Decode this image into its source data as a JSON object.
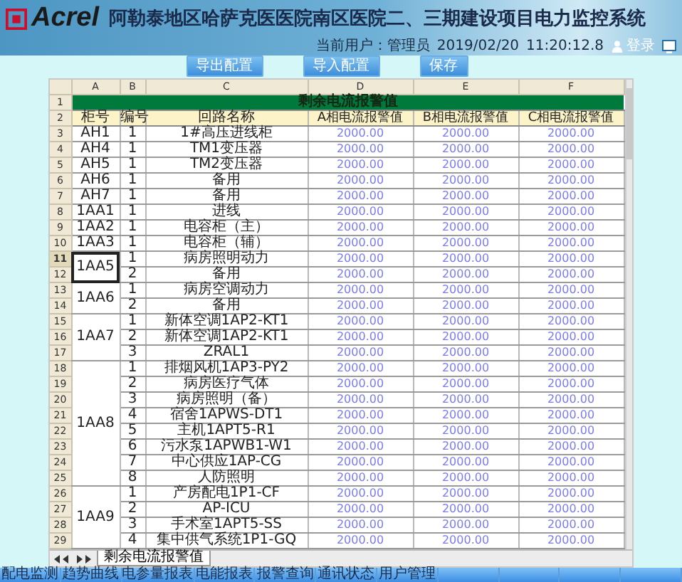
{
  "header": {
    "logo": "Acrel",
    "title": "阿勒泰地区哈萨克医医院南区医院二、三期建设项目电力监控系统",
    "user_label": "当前用户：",
    "user": "管理员",
    "date": "2019/02/20",
    "time": "11:20:12.8",
    "login": "登录"
  },
  "toolbar": [
    "导出配置",
    "导入配置",
    "保存"
  ],
  "sheet": {
    "column_letters": [
      "A",
      "B",
      "C",
      "D",
      "E",
      "F"
    ],
    "title_row_number": "1",
    "title": "剩余电流报警值",
    "header_row_number": "2",
    "headers": [
      "柜号",
      "编号",
      "回路名称",
      "A相电流报警值",
      "B相电流报警值",
      "C相电流报警值"
    ],
    "groups": [
      {
        "cabinet": "AH1",
        "selected": false,
        "rows": [
          {
            "row_number": "3",
            "no": "1",
            "name": "1#高压进线柜",
            "values": [
              "2000.00",
              "2000.00",
              "2000.00"
            ]
          }
        ]
      },
      {
        "cabinet": "AH4",
        "selected": false,
        "rows": [
          {
            "row_number": "4",
            "no": "1",
            "name": "TM1变压器",
            "values": [
              "2000.00",
              "2000.00",
              "2000.00"
            ]
          }
        ]
      },
      {
        "cabinet": "AH5",
        "selected": false,
        "rows": [
          {
            "row_number": "5",
            "no": "1",
            "name": "TM2变压器",
            "values": [
              "2000.00",
              "2000.00",
              "2000.00"
            ]
          }
        ]
      },
      {
        "cabinet": "AH6",
        "selected": false,
        "rows": [
          {
            "row_number": "6",
            "no": "1",
            "name": "备用",
            "values": [
              "2000.00",
              "2000.00",
              "2000.00"
            ]
          }
        ]
      },
      {
        "cabinet": "AH7",
        "selected": false,
        "rows": [
          {
            "row_number": "7",
            "no": "1",
            "name": "备用",
            "values": [
              "2000.00",
              "2000.00",
              "2000.00"
            ]
          }
        ]
      },
      {
        "cabinet": "1AA1",
        "selected": false,
        "rows": [
          {
            "row_number": "8",
            "no": "1",
            "name": "进线",
            "values": [
              "2000.00",
              "2000.00",
              "2000.00"
            ]
          }
        ]
      },
      {
        "cabinet": "1AA2",
        "selected": false,
        "rows": [
          {
            "row_number": "9",
            "no": "1",
            "name": "电容柜（主）",
            "values": [
              "2000.00",
              "2000.00",
              "2000.00"
            ]
          }
        ]
      },
      {
        "cabinet": "1AA3",
        "selected": false,
        "rows": [
          {
            "row_number": "10",
            "no": "1",
            "name": "电容柜（辅）",
            "values": [
              "2000.00",
              "2000.00",
              "2000.00"
            ]
          }
        ]
      },
      {
        "cabinet": "1AA5",
        "selected": true,
        "rows": [
          {
            "row_number": "11",
            "no": "1",
            "name": "病房照明动力",
            "values": [
              "2000.00",
              "2000.00",
              "2000.00"
            ]
          },
          {
            "row_number": "12",
            "no": "2",
            "name": "备用",
            "values": [
              "2000.00",
              "2000.00",
              "2000.00"
            ]
          }
        ]
      },
      {
        "cabinet": "1AA6",
        "selected": false,
        "rows": [
          {
            "row_number": "13",
            "no": "1",
            "name": "病房空调动力",
            "values": [
              "2000.00",
              "2000.00",
              "2000.00"
            ]
          },
          {
            "row_number": "14",
            "no": "2",
            "name": "备用",
            "values": [
              "2000.00",
              "2000.00",
              "2000.00"
            ]
          }
        ]
      },
      {
        "cabinet": "1AA7",
        "selected": false,
        "rows": [
          {
            "row_number": "15",
            "no": "1",
            "name": "新体空调1AP2-KT1",
            "values": [
              "2000.00",
              "2000.00",
              "2000.00"
            ]
          },
          {
            "row_number": "16",
            "no": "2",
            "name": "新体空调1AP2-KT1",
            "values": [
              "2000.00",
              "2000.00",
              "2000.00"
            ]
          },
          {
            "row_number": "17",
            "no": "3",
            "name": "ZRAL1",
            "values": [
              "2000.00",
              "2000.00",
              "2000.00"
            ]
          }
        ]
      },
      {
        "cabinet": "1AA8",
        "selected": false,
        "rows": [
          {
            "row_number": "18",
            "no": "1",
            "name": "排烟风机1AP3-PY2",
            "values": [
              "2000.00",
              "2000.00",
              "2000.00"
            ]
          },
          {
            "row_number": "19",
            "no": "2",
            "name": "病房医疗气体",
            "values": [
              "2000.00",
              "2000.00",
              "2000.00"
            ]
          },
          {
            "row_number": "20",
            "no": "3",
            "name": "病房照明（备）",
            "values": [
              "2000.00",
              "2000.00",
              "2000.00"
            ]
          },
          {
            "row_number": "21",
            "no": "4",
            "name": "宿舍1APWS-DT1",
            "values": [
              "2000.00",
              "2000.00",
              "2000.00"
            ]
          },
          {
            "row_number": "22",
            "no": "5",
            "name": "主机1APT5-R1",
            "values": [
              "2000.00",
              "2000.00",
              "2000.00"
            ]
          },
          {
            "row_number": "23",
            "no": "6",
            "name": "污水泵1APWB1-W1",
            "values": [
              "2000.00",
              "2000.00",
              "2000.00"
            ]
          },
          {
            "row_number": "24",
            "no": "7",
            "name": "中心供应1AP-CG",
            "values": [
              "2000.00",
              "2000.00",
              "2000.00"
            ]
          },
          {
            "row_number": "25",
            "no": "8",
            "name": "人防照明",
            "values": [
              "2000.00",
              "2000.00",
              "2000.00"
            ]
          }
        ]
      },
      {
        "cabinet": "1AA9",
        "selected": false,
        "rows": [
          {
            "row_number": "26",
            "no": "1",
            "name": "产房配电1P1-CF",
            "values": [
              "2000.00",
              "2000.00",
              "2000.00"
            ]
          },
          {
            "row_number": "27",
            "no": "2",
            "name": "AP-ICU",
            "values": [
              "2000.00",
              "2000.00",
              "2000.00"
            ]
          },
          {
            "row_number": "28",
            "no": "3",
            "name": "手术室1APT5-SS",
            "values": [
              "2000.00",
              "2000.00",
              "2000.00"
            ]
          },
          {
            "row_number": "29",
            "no": "4",
            "name": "集中供气系统1P1-GQ",
            "values": [
              "2000.00",
              "2000.00",
              "2000.00"
            ]
          }
        ]
      }
    ],
    "tab": "剩余电流报警值"
  },
  "nav": [
    "配电监测",
    "趋势曲线",
    "电参量报表",
    "电能报表",
    "报警查询",
    "通讯状态",
    "用户管理"
  ]
}
